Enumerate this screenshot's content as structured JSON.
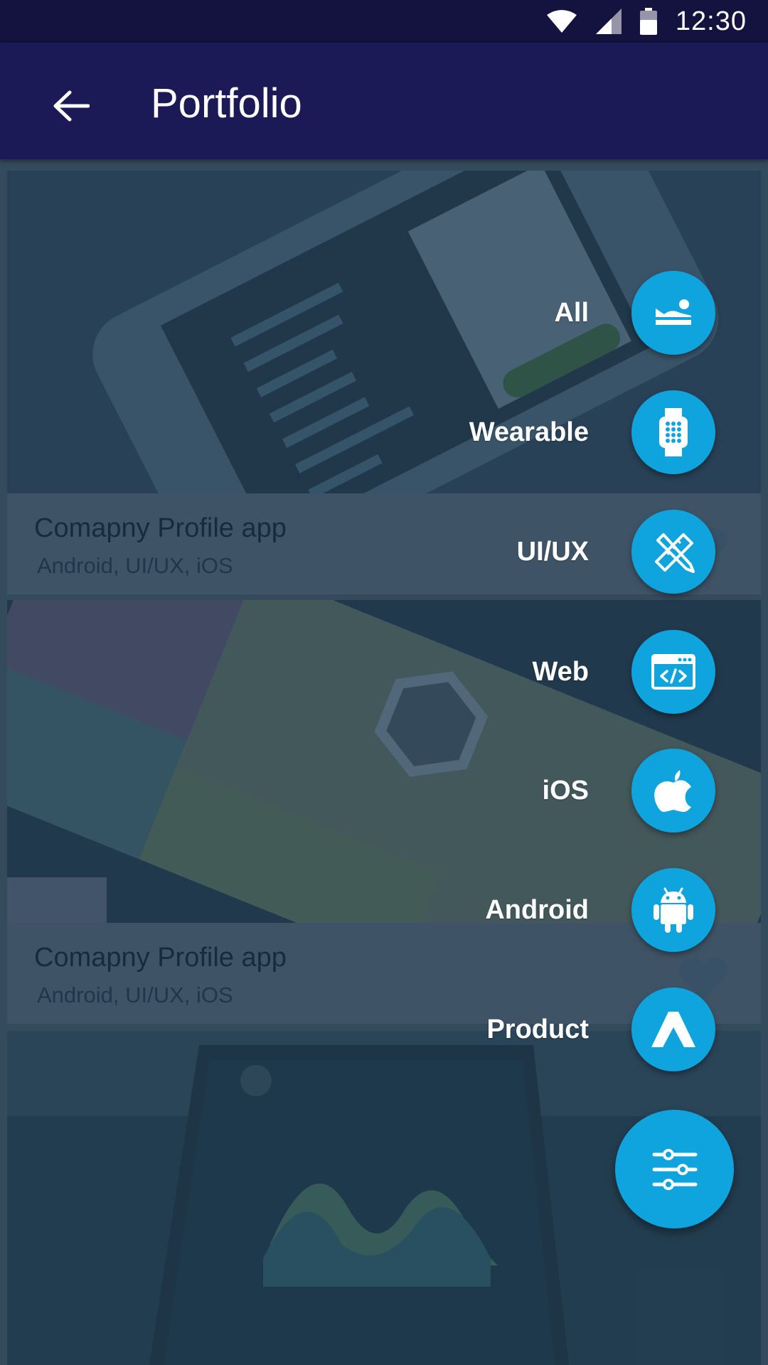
{
  "status_bar": {
    "time": "12:30"
  },
  "app_bar": {
    "title": "Portfolio"
  },
  "cards": [
    {
      "title": "Comapny Profile app",
      "tags": "Android, UI/UX, iOS"
    },
    {
      "title": "Comapny Profile app",
      "tags": "Android, UI/UX, iOS"
    },
    {
      "title": "",
      "tags": ""
    }
  ],
  "filter_menu": {
    "items": [
      {
        "label": "All",
        "icon": "landscape-icon"
      },
      {
        "label": "Wearable",
        "icon": "smartwatch-icon"
      },
      {
        "label": "UI/UX",
        "icon": "pencil-ruler-icon"
      },
      {
        "label": "Web",
        "icon": "code-window-icon"
      },
      {
        "label": "iOS",
        "icon": "apple-icon"
      },
      {
        "label": "Android",
        "icon": "android-icon"
      },
      {
        "label": "Product",
        "icon": "product-logo-icon"
      }
    ],
    "fab_icon": "sliders-icon"
  },
  "colors": {
    "status_bar": "#14123e",
    "app_bar": "#1c1a56",
    "accent": "#10a4de"
  }
}
